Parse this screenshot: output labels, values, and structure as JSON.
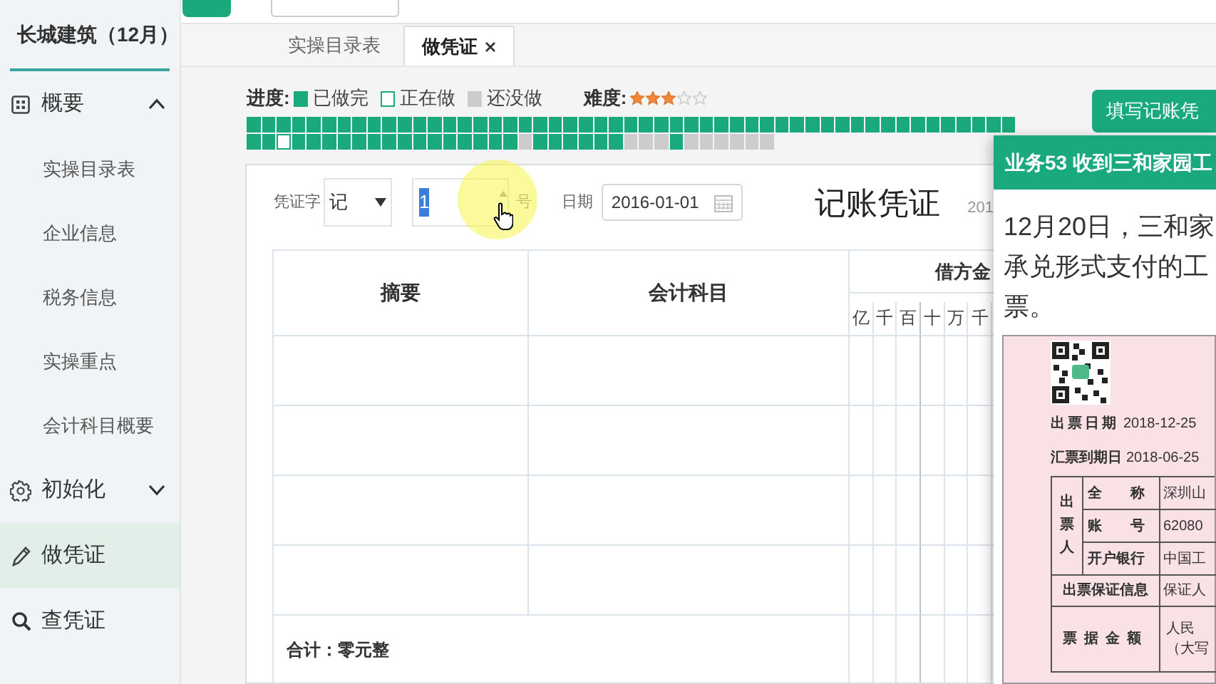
{
  "sidebar": {
    "title": "长城建筑（12月）",
    "items": [
      {
        "label": "概要",
        "kind": "group",
        "expanded": true,
        "selected": false,
        "children": [
          {
            "label": "实操目录表",
            "selected": false
          },
          {
            "label": "企业信息",
            "selected": false
          },
          {
            "label": "税务信息",
            "selected": false
          },
          {
            "label": "实操重点",
            "selected": false
          },
          {
            "label": "会计科目概要",
            "selected": false
          }
        ]
      },
      {
        "label": "初始化",
        "kind": "group",
        "expanded": false,
        "selected": false
      },
      {
        "label": "做凭证",
        "kind": "item",
        "selected": true
      },
      {
        "label": "查凭证",
        "kind": "item",
        "selected": false
      }
    ]
  },
  "tabs": [
    {
      "label": "实操目录表",
      "selected": false,
      "closable": false
    },
    {
      "label": "做凭证",
      "selected": true,
      "closable": true
    }
  ],
  "progress": {
    "label": "进度:",
    "legend": [
      {
        "kind": "done",
        "label": "已做完"
      },
      {
        "kind": "doing",
        "label": "正在做"
      },
      {
        "kind": "todo",
        "label": "还没做"
      }
    ],
    "difficulty_label": "难度:",
    "difficulty": {
      "stars": 3
    },
    "squares": [
      {
        "kind": "done"
      },
      {
        "kind": "done"
      },
      {
        "kind": "done"
      },
      {
        "kind": "done"
      },
      {
        "kind": "done"
      },
      {
        "kind": "done"
      },
      {
        "kind": "done"
      },
      {
        "kind": "done"
      },
      {
        "kind": "done"
      },
      {
        "kind": "done"
      },
      {
        "kind": "done"
      },
      {
        "kind": "done"
      },
      {
        "kind": "done"
      },
      {
        "kind": "done"
      },
      {
        "kind": "done"
      },
      {
        "kind": "done"
      },
      {
        "kind": "done"
      },
      {
        "kind": "done"
      },
      {
        "kind": "done"
      },
      {
        "kind": "done"
      },
      {
        "kind": "done"
      },
      {
        "kind": "done"
      },
      {
        "kind": "done"
      },
      {
        "kind": "done"
      },
      {
        "kind": "done"
      },
      {
        "kind": "done"
      },
      {
        "kind": "done"
      },
      {
        "kind": "done"
      },
      {
        "kind": "done"
      },
      {
        "kind": "done"
      },
      {
        "kind": "done"
      },
      {
        "kind": "done"
      },
      {
        "kind": "done"
      },
      {
        "kind": "done"
      },
      {
        "kind": "done"
      },
      {
        "kind": "done"
      },
      {
        "kind": "done"
      },
      {
        "kind": "done"
      },
      {
        "kind": "done"
      },
      {
        "kind": "done"
      },
      {
        "kind": "done"
      },
      {
        "kind": "done"
      },
      {
        "kind": "done"
      },
      {
        "kind": "done"
      },
      {
        "kind": "done"
      },
      {
        "kind": "done"
      },
      {
        "kind": "done"
      },
      {
        "kind": "done"
      },
      {
        "kind": "done"
      },
      {
        "kind": "done"
      },
      {
        "kind": "done"
      },
      {
        "kind": "done"
      },
      {
        "kind": "done"
      },
      {
        "kind": "doing"
      },
      {
        "kind": "done"
      },
      {
        "kind": "done"
      },
      {
        "kind": "done"
      },
      {
        "kind": "done"
      },
      {
        "kind": "done"
      },
      {
        "kind": "done"
      },
      {
        "kind": "done"
      },
      {
        "kind": "done"
      },
      {
        "kind": "done"
      },
      {
        "kind": "done"
      },
      {
        "kind": "done"
      },
      {
        "kind": "done"
      },
      {
        "kind": "done"
      },
      {
        "kind": "done"
      },
      {
        "kind": "done"
      },
      {
        "kind": "todo"
      },
      {
        "kind": "done"
      },
      {
        "kind": "done"
      },
      {
        "kind": "done"
      },
      {
        "kind": "done"
      },
      {
        "kind": "done"
      },
      {
        "kind": "done"
      },
      {
        "kind": "todo"
      },
      {
        "kind": "todo"
      },
      {
        "kind": "todo"
      },
      {
        "kind": "done"
      },
      {
        "kind": "todo"
      },
      {
        "kind": "todo"
      },
      {
        "kind": "todo"
      },
      {
        "kind": "todo"
      },
      {
        "kind": "todo"
      },
      {
        "kind": "todo"
      }
    ]
  },
  "fill_voucher_button": "填写记账凭",
  "voucher": {
    "word_label": "凭证字",
    "word": "记",
    "number": "1",
    "number_selected": true,
    "number_suffix": "号",
    "date_label": "日期",
    "date": "2016-01-01",
    "title": "记账凭证",
    "title_side": "201",
    "columns": {
      "summary": "摘要",
      "account": "会计科目",
      "debit": "借方金",
      "digits": [
        "亿",
        "千",
        "百",
        "十",
        "万",
        "千"
      ]
    },
    "total": "合计：零元整"
  },
  "task_panel": {
    "title": "业务53 收到三和家园工",
    "lines": [
      "12月20日，三和家",
      "承兑形式支付的工",
      "票。"
    ],
    "document": {
      "issue_date_label": "出票日期",
      "issue_date": "2018-12-25",
      "due_date_label": "汇票到期日",
      "due_date": "2018-06-25",
      "drawer_label": "出票人",
      "drawer_rows": [
        {
          "label": "全　　称",
          "value": "深圳山"
        },
        {
          "label": "账　　号",
          "value": "62080"
        },
        {
          "label": "开户银行",
          "value": "中国工"
        }
      ],
      "guarantee_label": "出票保证信息",
      "guarantee_value": "保证人",
      "amount_label": "票据金额",
      "amount_value": [
        "人民",
        "（大写"
      ]
    }
  }
}
